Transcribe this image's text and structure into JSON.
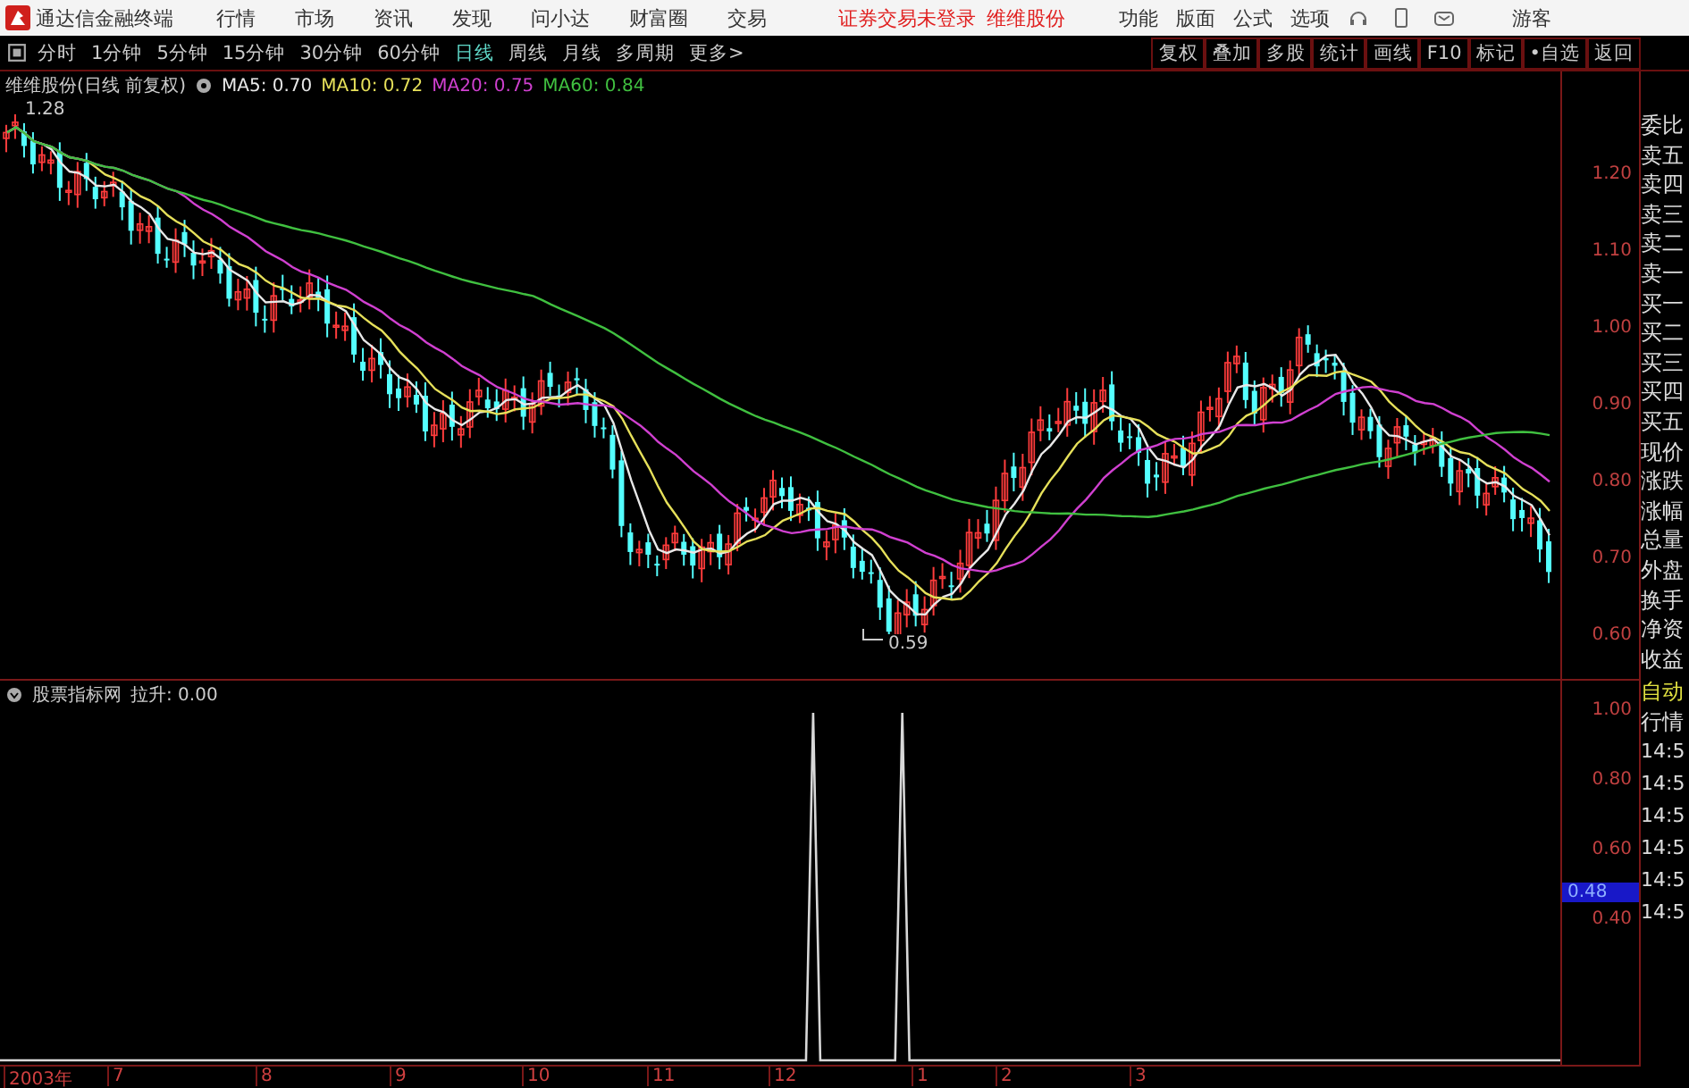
{
  "title_bar": {
    "app_name": "通达信金融终端",
    "menus": [
      "行情",
      "市场",
      "资讯",
      "发现",
      "问小达",
      "财富圈",
      "交易"
    ],
    "notice": "证券交易未登录",
    "stock": "维维股份",
    "tools": [
      "功能",
      "版面",
      "公式",
      "选项"
    ],
    "user": "游客"
  },
  "period_tabs": [
    {
      "label": "分时",
      "selected": false
    },
    {
      "label": "1分钟",
      "selected": false
    },
    {
      "label": "5分钟",
      "selected": false
    },
    {
      "label": "15分钟",
      "selected": false
    },
    {
      "label": "30分钟",
      "selected": false
    },
    {
      "label": "60分钟",
      "selected": false
    },
    {
      "label": "日线",
      "selected": true
    },
    {
      "label": "周线",
      "selected": false
    },
    {
      "label": "月线",
      "selected": false
    },
    {
      "label": "多周期",
      "selected": false
    },
    {
      "label": "更多>",
      "selected": false
    }
  ],
  "tool_buttons": [
    "复权",
    "叠加",
    "多股",
    "统计",
    "画线",
    "F10",
    "标记",
    "•自选",
    "返回"
  ],
  "price_chart": {
    "title": "维维股份(日线 前复权)",
    "ma": [
      {
        "label": "MA5: 0.70",
        "color": "#e8e8e8"
      },
      {
        "label": "MA10: 0.72",
        "color": "#e6e05a"
      },
      {
        "label": "MA20: 0.75",
        "color": "#d040d0"
      },
      {
        "label": "MA60: 0.84",
        "color": "#40c040"
      }
    ],
    "high_label": "1.28",
    "low_label": "0.59",
    "yticks": [
      "1.20",
      "1.10",
      "1.00",
      "0.90",
      "0.80",
      "0.70",
      "0.60"
    ]
  },
  "indicator": {
    "title": "股票指标网",
    "reading": "拉升: 0.00",
    "yticks": [
      "1.00",
      "0.80",
      "0.60",
      "0.40"
    ],
    "current": "0.48"
  },
  "x_axis": [
    "2003年",
    "7",
    "8",
    "9",
    "10",
    "11",
    "12",
    "1",
    "2",
    "3"
  ],
  "sidebar": {
    "quote_labels": [
      "委比",
      "卖五",
      "卖四",
      "卖三",
      "卖二",
      "卖一",
      "买一",
      "买二",
      "买三",
      "买四",
      "买五",
      "现价",
      "涨跌",
      "涨幅",
      "总量",
      "外盘",
      "换手",
      "净资",
      "收益"
    ],
    "auto": "自动",
    "market": "行情",
    "times": [
      "14:5",
      "14:5",
      "14:5",
      "14:5",
      "14:5",
      "14:5"
    ]
  }
}
